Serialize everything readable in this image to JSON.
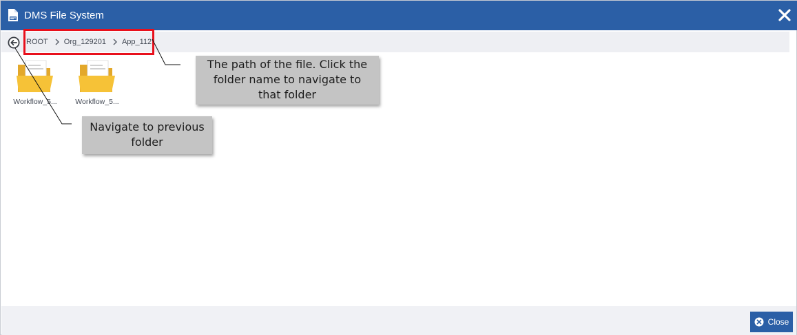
{
  "window": {
    "title": "DMS File System",
    "title_icon": "file-icon",
    "close_icon": "close-icon"
  },
  "breadcrumb": {
    "back_icon": "back-arrow-icon",
    "items": [
      "ROOT",
      "Org_129201",
      "App_112"
    ],
    "separator_icon": "chevron-right-icon"
  },
  "folders": [
    {
      "label": "Workflow_5...",
      "icon": "folder-icon"
    },
    {
      "label": "Workflow_5...",
      "icon": "folder-icon"
    }
  ],
  "footer": {
    "close_label": "Close",
    "close_icon": "close-circle-icon"
  },
  "annotations": {
    "path_callout": [
      "The path of the file. Click the",
      "folder name to navigate to",
      "that folder"
    ],
    "back_callout": [
      "Navigate to previous",
      "folder"
    ]
  },
  "colors": {
    "titlebar": "#2b5fa6",
    "highlight": "#e8101c",
    "folder": "#f6c237",
    "callout": "#c4c4c4"
  }
}
